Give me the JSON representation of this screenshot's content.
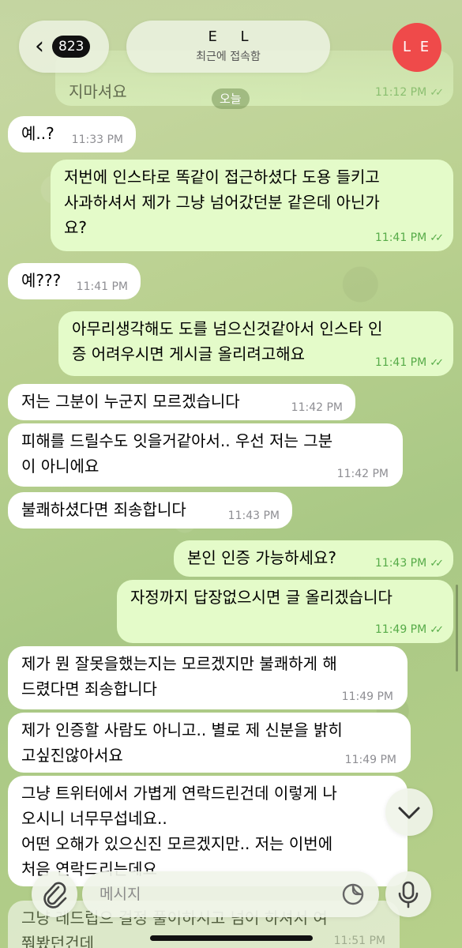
{
  "header": {
    "back_count": "823",
    "chat_name": "E L",
    "status": "최근에 접속함",
    "avatar_initials": "L E",
    "avatar_color": "#ef4a4a"
  },
  "date_separator": "오늘",
  "messages": [
    {
      "dir": "out",
      "lines": [
        "지마셔요"
      ],
      "time": "11:12 PM",
      "partial": true
    },
    {
      "dir": "in",
      "lines": [
        "예..?"
      ],
      "time": "11:33 PM"
    },
    {
      "dir": "out",
      "lines": [
        "저번에 인스타로 똑같이 접근하셨다 도용 들키고",
        "사과하셔서 제가 그냥 넘어갔던분 같은데 아닌가",
        "요?"
      ],
      "time": "11:41 PM"
    },
    {
      "dir": "in",
      "lines": [
        "예???"
      ],
      "time": "11:41 PM"
    },
    {
      "dir": "out",
      "lines": [
        "아무리생각해도 도를 넘으신것같아서 인스타 인",
        "증 어려우시면 게시글 올리려고해요"
      ],
      "time": "11:41 PM"
    },
    {
      "dir": "in",
      "lines": [
        "저는 그분이 누군지 모르겠습니다"
      ],
      "time": "11:42 PM"
    },
    {
      "dir": "in",
      "lines": [
        "피해를 드릴수도 잇을거같아서.. 우선 저는 그분",
        "이 아니에요"
      ],
      "time": "11:42 PM"
    },
    {
      "dir": "in",
      "lines": [
        "불쾌하셨다면 죄송합니다"
      ],
      "time": "11:43 PM"
    },
    {
      "dir": "out",
      "lines": [
        "본인 인증 가능하세요?"
      ],
      "time": "11:43 PM"
    },
    {
      "dir": "out",
      "lines": [
        "자정까지 답장없으시면 글 올리겠습니다"
      ],
      "time": "11:49 PM"
    },
    {
      "dir": "in",
      "lines": [
        "제가 뭔 잘못을했는지는 모르겠지만 불쾌하게 해",
        "드렸다면 죄송합니다"
      ],
      "time": "11:49 PM"
    },
    {
      "dir": "in",
      "lines": [
        "제가 인증할 사람도 아니고.. 별로 제 신분을 밝히",
        "고싶진않아서요"
      ],
      "time": "11:49 PM"
    },
    {
      "dir": "in",
      "lines": [
        "그냥 트위터에서 가볍게 연락드린건데 이렇게 나",
        "오시니 너무무섭네요..",
        "어떤 오해가 있으신진 모르겠지만.. 저는 이번에",
        "처음 연락드리는데요"
      ],
      "time": ""
    },
    {
      "dir": "in",
      "lines": [
        "그냥 레드립으 걸정 풀이하시고 넘어 하셔서 여",
        "쭤봤던건데"
      ],
      "time": "11:51 PM",
      "partial": true
    }
  ],
  "input": {
    "placeholder": "메시지"
  },
  "icons": {
    "back": "chevron-left-icon",
    "attach": "paperclip-icon",
    "sticker": "sticker-icon",
    "mic": "microphone-icon",
    "scroll": "chevron-down-icon"
  }
}
